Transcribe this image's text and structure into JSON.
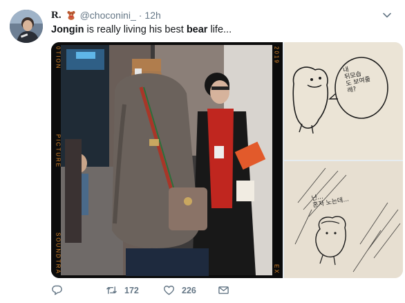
{
  "tweet": {
    "display_name": "R.",
    "display_emoji": "teddy-bear-emoji",
    "handle": "@choconini_",
    "separator": "·",
    "time": "12h",
    "text_parts": {
      "p1": "Jongin",
      "p2": " is really living his best ",
      "p3": "bear",
      "p4": " life..."
    },
    "media": {
      "film_left_labels": [
        "0TION",
        "PICTURE",
        "SOUNDTRA"
      ],
      "film_right_labels": [
        "2019",
        "EX"
      ],
      "drawing_top_bubble": [
        "내",
        "뒤모습",
        "도 보여줄",
        "래?"
      ],
      "drawing_bottom_text": [
        "난...",
        "혼자 노는데..."
      ]
    },
    "actions": {
      "reply_count": "",
      "retweet_count": "172",
      "like_count": "226"
    }
  },
  "colors": {
    "text_primary": "#14171a",
    "text_secondary": "#657786",
    "film_label": "#e08a2c"
  }
}
